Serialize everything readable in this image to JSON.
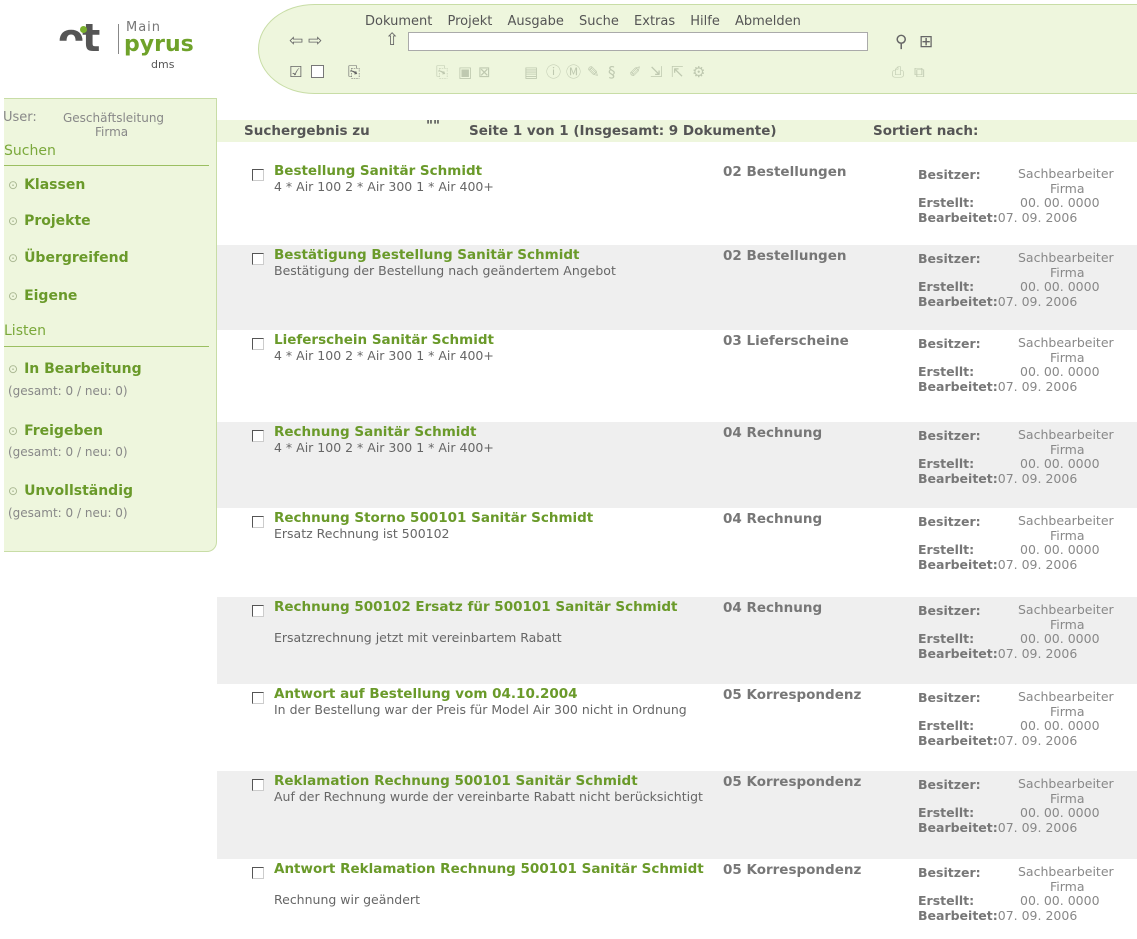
{
  "logo": {
    "brand_top": "Main",
    "brand": "pyrus",
    "brand_sub": "dms"
  },
  "menu": [
    "Dokument",
    "Projekt",
    "Ausgabe",
    "Suche",
    "Extras",
    "Hilfe",
    "Abmelden"
  ],
  "address_value": "",
  "sidebar": {
    "user_label": "User:",
    "user_name": "Geschäftsleitung",
    "user_org": "Firma",
    "search_heading": "Suchen",
    "search_items": [
      "Klassen",
      "Projekte",
      "Übergreifend",
      "Eigene"
    ],
    "lists_heading": "Listen",
    "list_items": [
      {
        "label": "In Bearbeitung",
        "sub": "(gesamt: 0 / neu: 0)"
      },
      {
        "label": "Freigeben",
        "sub": "(gesamt: 0 / neu: 0)"
      },
      {
        "label": "Unvollständig",
        "sub": "(gesamt: 0 / neu: 0)"
      }
    ]
  },
  "results": {
    "label": "Suchergebnis zu",
    "query": "\"\"",
    "page_info": "Seite 1 von 1 (Insgesamt: 9 Dokumente)",
    "sort_label": "Sortiert nach:",
    "meta_labels": {
      "owner": "Besitzer:",
      "created": "Erstellt:",
      "edited": "Bearbeitet:"
    },
    "rows": [
      {
        "title": "Bestellung Sanitär Schmidt",
        "desc": "4 * Air 100 2 * Air 300 1 * Air 400+",
        "class": "02 Bestellungen",
        "owner": "Sachbearbeiter",
        "owner_org": "Firma",
        "created": "00. 00. 0000",
        "edited": "07. 09. 2006"
      },
      {
        "title": "Bestätigung Bestellung Sanitär Schmidt",
        "desc": "Bestätigung der Bestellung nach geändertem Angebot",
        "class": "02 Bestellungen",
        "owner": "Sachbearbeiter",
        "owner_org": "Firma",
        "created": "00. 00. 0000",
        "edited": "07. 09. 2006"
      },
      {
        "title": "Lieferschein Sanitär Schmidt",
        "desc": "4 * Air 100 2 * Air 300 1 * Air 400+",
        "class": "03 Lieferscheine",
        "owner": "Sachbearbeiter",
        "owner_org": "Firma",
        "created": "00. 00. 0000",
        "edited": "07. 09. 2006"
      },
      {
        "title": "Rechnung Sanitär Schmidt",
        "desc": "4 * Air 100 2 * Air 300 1 * Air 400+",
        "class": "04 Rechnung",
        "owner": "Sachbearbeiter",
        "owner_org": "Firma",
        "created": "00. 00. 0000",
        "edited": "07. 09. 2006"
      },
      {
        "title": "Rechnung Storno 500101 Sanitär Schmidt",
        "desc": "Ersatz Rechnung ist 500102",
        "class": "04 Rechnung",
        "owner": "Sachbearbeiter",
        "owner_org": "Firma",
        "created": "00. 00. 0000",
        "edited": "07. 09. 2006"
      },
      {
        "title": "Rechnung 500102 Ersatz für 500101 Sanitär Schmidt",
        "desc": "Ersatzrechnung jetzt mit vereinbartem Rabatt",
        "class": "04 Rechnung",
        "owner": "Sachbearbeiter",
        "owner_org": "Firma",
        "created": "00. 00. 0000",
        "edited": "07. 09. 2006"
      },
      {
        "title": "Antwort auf Bestellung vom 04.10.2004",
        "desc": "In der Bestellung war der Preis für Model Air 300 nicht in Ordnung",
        "class": "05 Korrespondenz",
        "owner": "Sachbearbeiter",
        "owner_org": "Firma",
        "created": "00. 00. 0000",
        "edited": "07. 09. 2006"
      },
      {
        "title": "Reklamation Rechnung 500101 Sanitär Schmidt",
        "desc": "Auf der Rechnung wurde der vereinbarte Rabatt nicht berücksichtigt",
        "class": "05 Korrespondenz",
        "owner": "Sachbearbeiter",
        "owner_org": "Firma",
        "created": "00. 00. 0000",
        "edited": "07. 09. 2006"
      },
      {
        "title": "Antwort Reklamation Rechnung 500101 Sanitär Schmidt",
        "desc": "Rechnung wir geändert",
        "class": "05 Korrespondenz",
        "owner": "Sachbearbeiter",
        "owner_org": "Firma",
        "created": "00. 00. 0000",
        "edited": "07. 09. 2006"
      }
    ]
  }
}
